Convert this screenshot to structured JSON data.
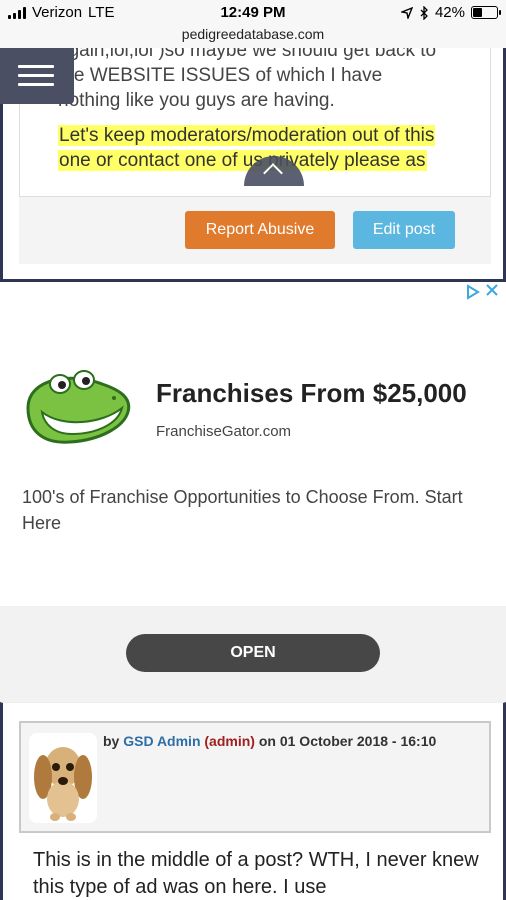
{
  "status_bar": {
    "carrier": "Verizon",
    "network": "LTE",
    "time": "12:49 PM",
    "battery_percent": "42%",
    "battery_level": 0.42,
    "icons": [
      "signal-icon",
      "location-icon",
      "bluetooth-icon",
      "battery-icon"
    ]
  },
  "browser": {
    "url": "pedigreedatabase.com"
  },
  "post_top": {
    "text_lines": [
      "again,lol,lol )so maybe we should get back to",
      "the WEBSITE ISSUES of which I have",
      "nothing like you guys are having."
    ],
    "highlighted_lines": [
      "Let's keep moderators/moderation out of this",
      "one or contact one of us privately please as"
    ],
    "buttons": {
      "report": "Report Abusive",
      "edit": "Edit post"
    }
  },
  "ad": {
    "headline": "Franchises From $25,000",
    "domain": "FranchiseGator.com",
    "description": "100's of Franchise Opportunities to Choose From. Start Here",
    "cta": "OPEN",
    "choices_icons": [
      "ad-choices-icon",
      "close-icon"
    ]
  },
  "post_next": {
    "by_label": "by",
    "username": "GSD Admin",
    "role": "(admin)",
    "on_label": "on",
    "date": "01 October 2018 - 16:10",
    "body": "This is in the middle of a post? WTH, I never knew this type of ad was on here. I use"
  },
  "colors": {
    "report_button": "#e07b2e",
    "edit_button": "#5bb7e0",
    "highlight": "#ffff66",
    "username": "#2e6ea6",
    "role": "#a01f1f",
    "open_button": "#474747"
  }
}
